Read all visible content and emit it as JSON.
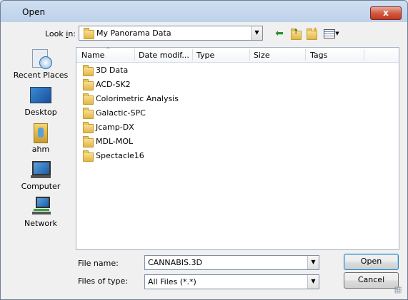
{
  "window": {
    "title": "Open",
    "close_label": "x"
  },
  "look_in": {
    "label_pre": "Look ",
    "label_mn": "i",
    "label_post": "n:",
    "value": "My Panorama Data"
  },
  "toolbar_icons": [
    "back-icon",
    "up-folder-icon",
    "new-folder-icon",
    "views-menu-icon"
  ],
  "places": [
    {
      "id": "recent-places",
      "label": "Recent Places"
    },
    {
      "id": "desktop",
      "label": "Desktop"
    },
    {
      "id": "ahm",
      "label": "ahm"
    },
    {
      "id": "computer",
      "label": "Computer"
    },
    {
      "id": "network",
      "label": "Network"
    }
  ],
  "columns": [
    "Name",
    "Date modif...",
    "Type",
    "Size",
    "Tags"
  ],
  "files": [
    "3D Data",
    "ACD-SK2",
    "Colorimetric Analysis",
    "Galactic-SPC",
    "Jcamp-DX",
    "MDL-MOL",
    "Spectacle16"
  ],
  "file_name": {
    "label": "File name:",
    "value": "CANNABIS.3D"
  },
  "file_type": {
    "label": "Files of type:",
    "value": "All Files (*.*)"
  },
  "buttons": {
    "open": "Open",
    "cancel": "Cancel"
  },
  "colors": {
    "selection_accent": "#3c7fb1",
    "title_close": "#c0391f"
  }
}
